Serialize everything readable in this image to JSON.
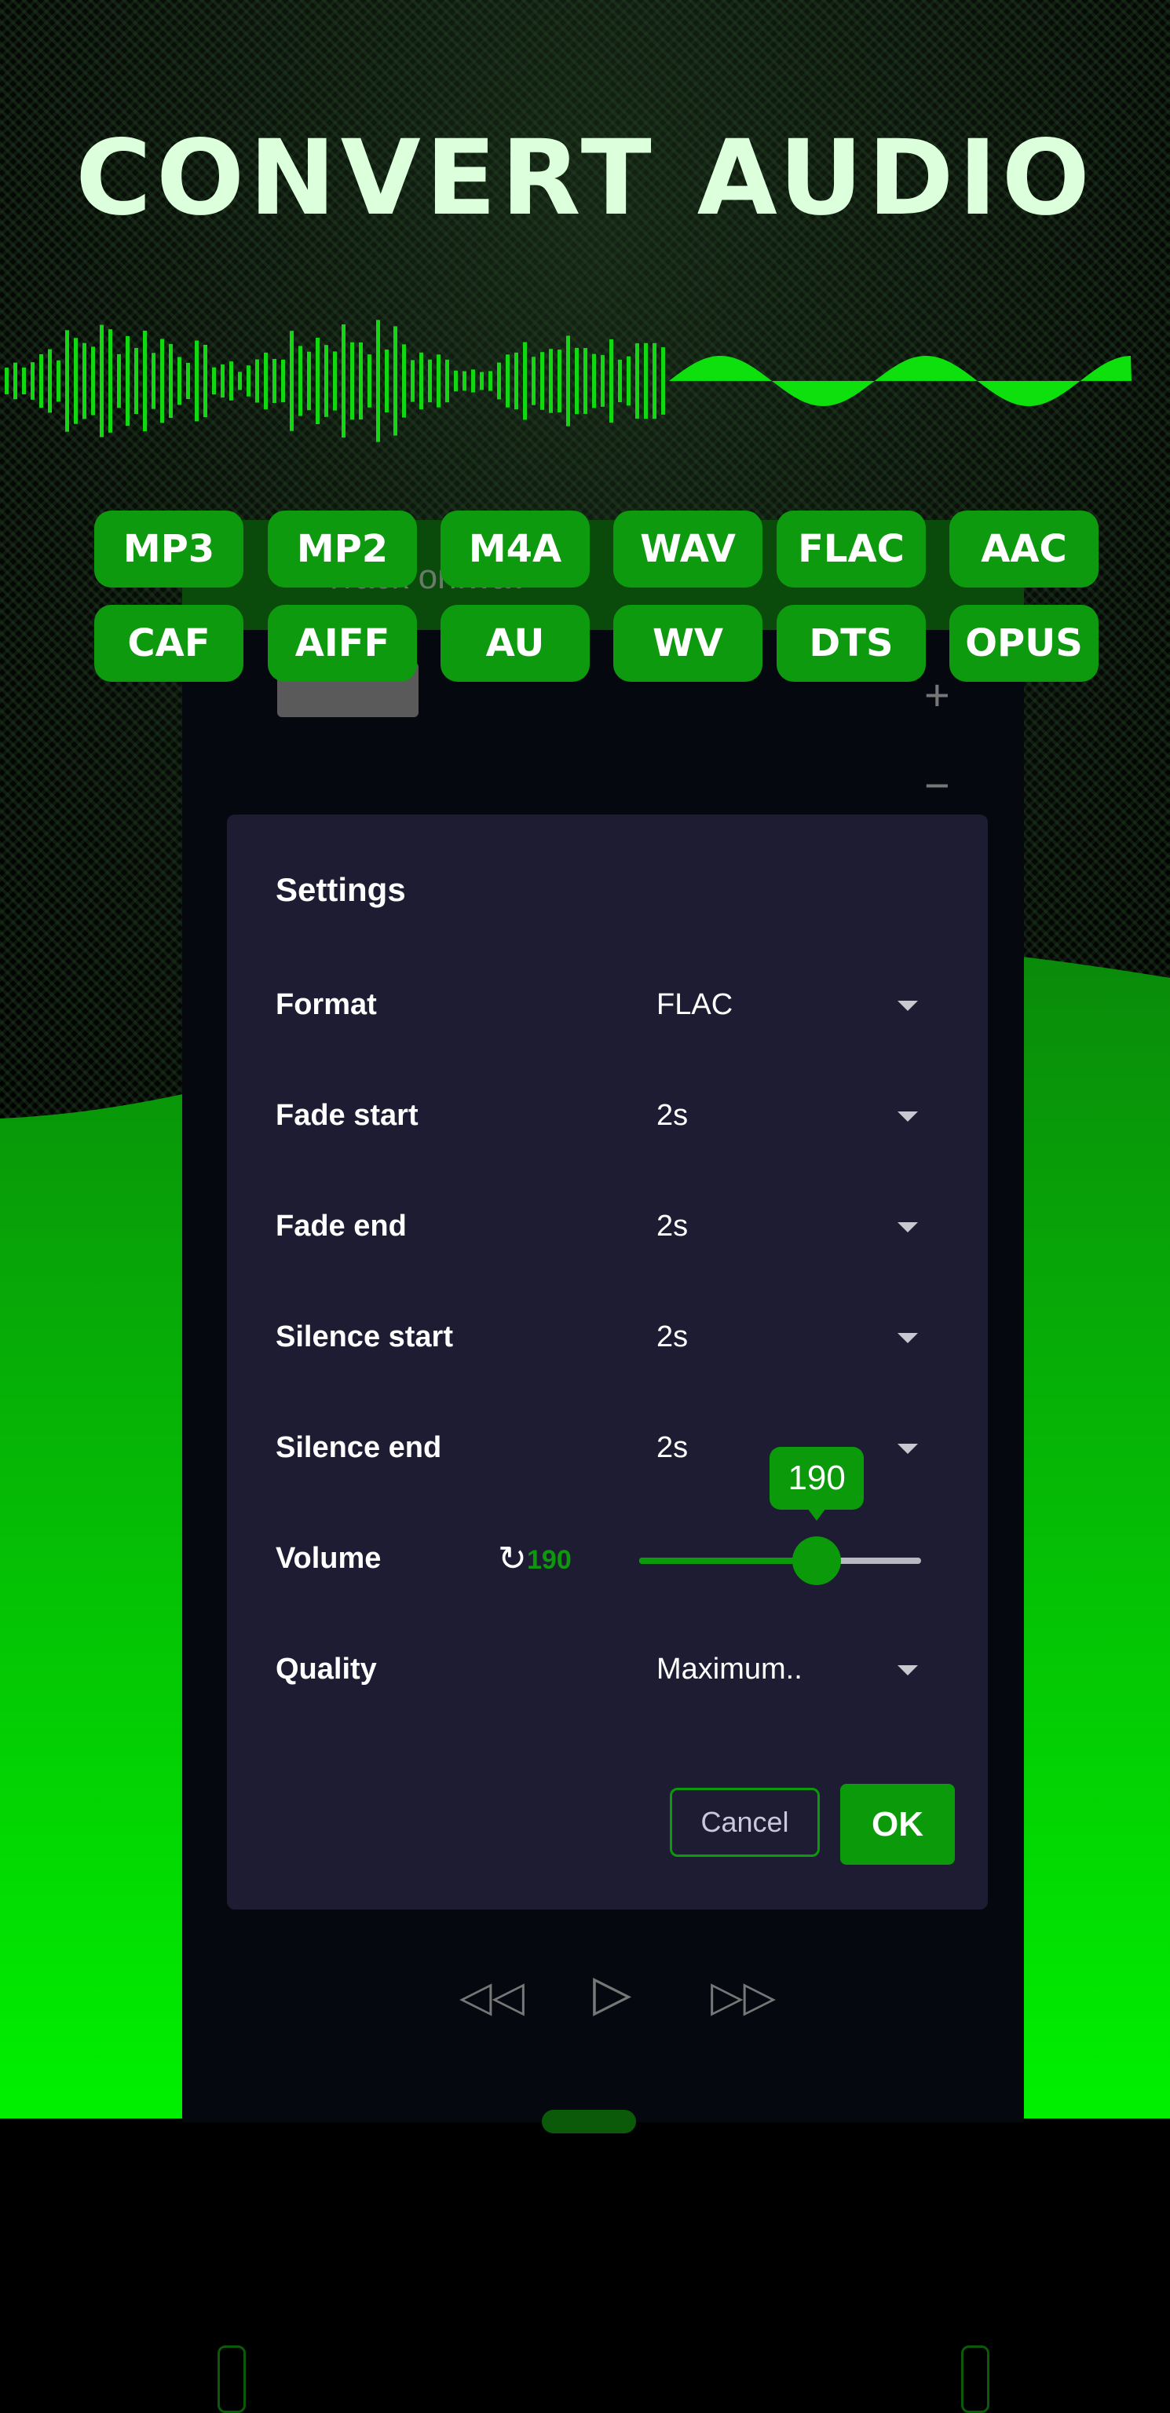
{
  "headline": "CONVERT AUDIO",
  "colors": {
    "accent": "#0a9a0a",
    "chip": "#0e9a0e",
    "bright_green": "#00e000",
    "dialog_bg": "#1e1c33"
  },
  "formats": [
    "MP3",
    "MP2",
    "M4A",
    "WAV",
    "FLAC",
    "AAC",
    "CAF",
    "AIFF",
    "AU",
    "WV",
    "DTS",
    "OPUS"
  ],
  "background_app": {
    "file_title": "Track on.wav",
    "zoom_in": "+",
    "zoom_out": "−"
  },
  "dialog": {
    "title": "Settings",
    "rows": [
      {
        "label": "Format",
        "value": "FLAC"
      },
      {
        "label": "Fade start",
        "value": "2s"
      },
      {
        "label": "Fade end",
        "value": "2s"
      },
      {
        "label": "Silence start",
        "value": "2s"
      },
      {
        "label": "Silence end",
        "value": "2s"
      }
    ],
    "volume": {
      "label": "Volume",
      "value": "190",
      "tooltip": "190",
      "fraction": 0.63,
      "reset_icon": "refresh-icon"
    },
    "quality": {
      "label": "Quality",
      "value": "Maximum.."
    },
    "cancel": "Cancel",
    "ok": "OK"
  },
  "player": {
    "rewind_icon": "rewind-icon",
    "play_icon": "play-icon",
    "forward_icon": "fast-forward-icon"
  }
}
